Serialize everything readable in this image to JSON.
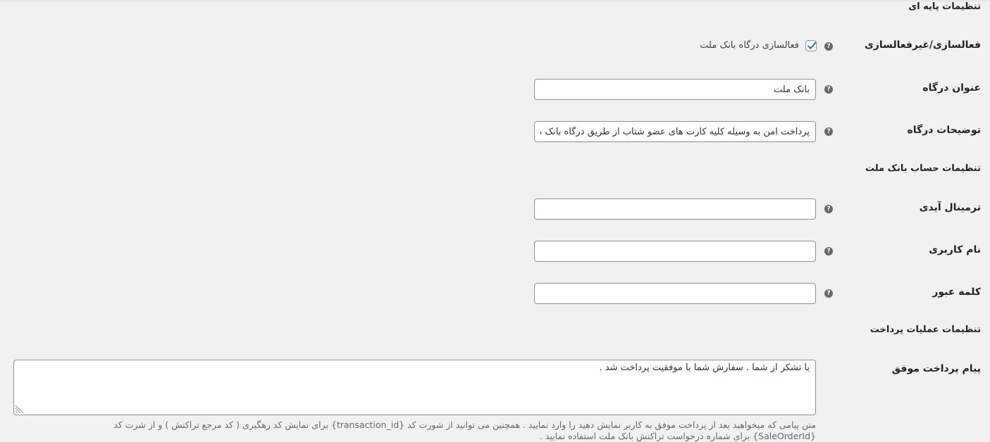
{
  "sections": {
    "basic": "تنظیمات پایه ای",
    "account": "تنظیمات حساب بانک ملت",
    "payment": "تنظیمات عملیات پرداخت"
  },
  "enable": {
    "label": "فعالسازی/غیرفعالسازی",
    "checkbox_label": "فعالسازی درگاه بانک ملت",
    "checked": true
  },
  "title_field": {
    "label": "عنوان درگاه",
    "value": "بانک ملت"
  },
  "description_field": {
    "label": "توضیحات درگاه",
    "value": "پرداخت امن به وسیله کلیه کارت های عضو شتاب از طریق درگاه بانک ملت"
  },
  "terminal_field": {
    "label": "ترمینال آیدی",
    "value": ""
  },
  "username_field": {
    "label": "نام کاربری",
    "value": ""
  },
  "password_field": {
    "label": "کلمه عبور",
    "value": ""
  },
  "success_message": {
    "label": "پیام پرداخت موفق",
    "value": "با تشکر از شما . سفارش شما با موفقیت پرداخت شد .",
    "description_line1": "متن پیامی که میخواهید بعد از پرداخت موفق به کاربر نمایش دهید را وارد نمایید . همچنین می توانید از شورت کد {transaction_id} برای نمایش کد رهگیری ( کد مرجع تراکنش ) و از شرت کد",
    "description_line2": "{SaleOrderId} برای شماره درخواست تراکنش بانک ملت استفاده نمایید ."
  },
  "help_symbol": "?",
  "colors": {
    "accent": "#2271b1",
    "background": "#f1f1f1",
    "border": "#8c8f94",
    "text": "#1d2327",
    "muted": "#646970"
  }
}
